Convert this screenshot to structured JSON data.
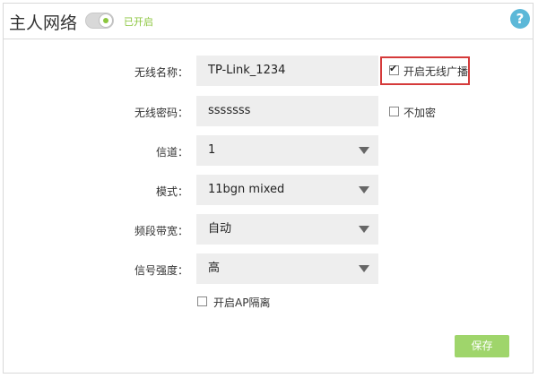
{
  "header": {
    "title": "主人网络",
    "toggle_status": "已开启",
    "toggle_on": true,
    "help_label": "?"
  },
  "form": {
    "ssid": {
      "label": "无线名称：",
      "value": "TP-Link_1234"
    },
    "broadcast": {
      "label": "开启无线广播",
      "checked": true
    },
    "password": {
      "label": "无线密码：",
      "value": "sssssss"
    },
    "no_encrypt": {
      "label": "不加密",
      "checked": false
    },
    "channel": {
      "label": "信道：",
      "value": "1"
    },
    "mode": {
      "label": "模式：",
      "value": "11bgn mixed"
    },
    "bandwidth": {
      "label": "频段带宽：",
      "value": "自动"
    },
    "signal": {
      "label": "信号强度：",
      "value": "高"
    },
    "ap_isolation": {
      "label": "开启AP隔离",
      "checked": false
    },
    "save_label": "保存"
  },
  "colors": {
    "accent_green": "#8cc63f",
    "save_button": "#9fd56b",
    "help_blue": "#5cb8d8",
    "highlight_red": "#d53a3a",
    "field_bg": "#eeeeee"
  }
}
